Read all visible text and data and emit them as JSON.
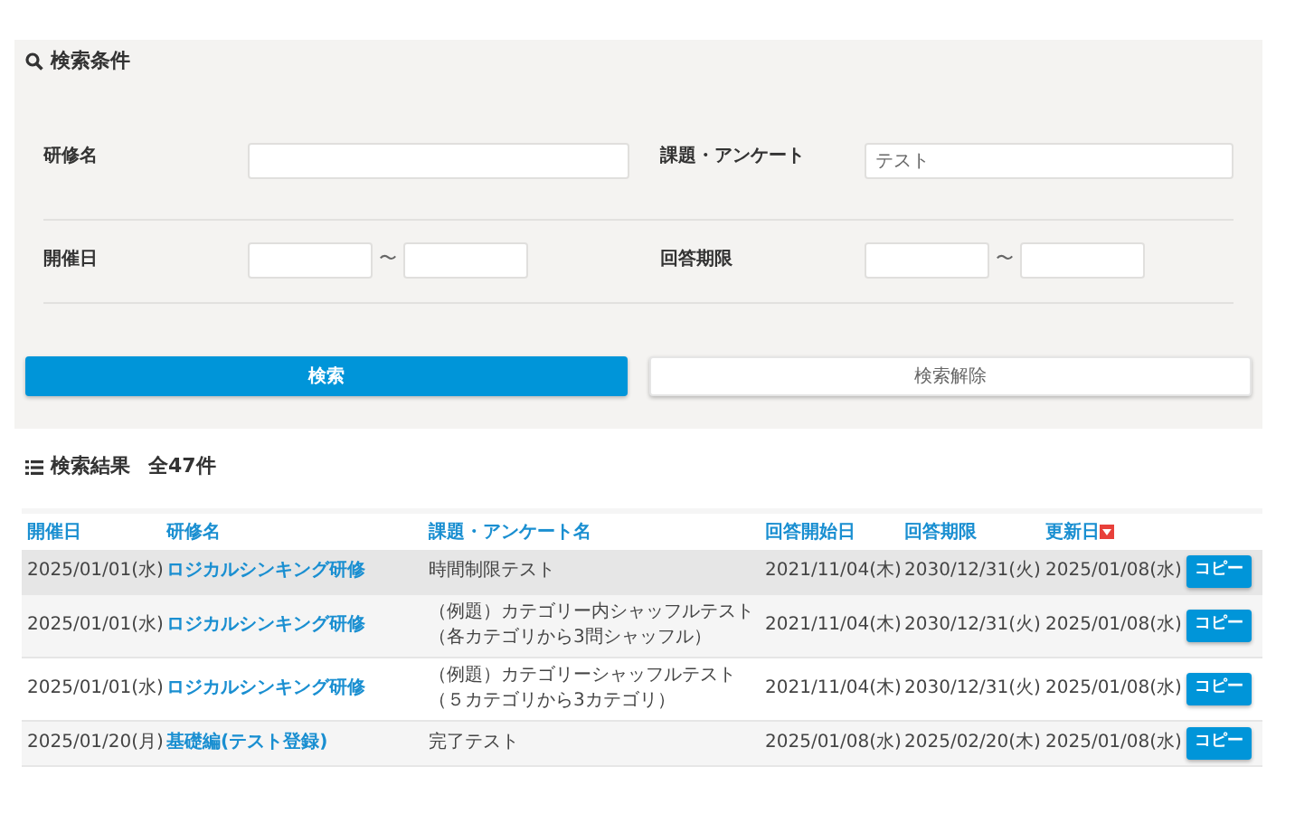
{
  "search": {
    "title": "検索条件",
    "fields": [
      {
        "label": "研修名",
        "kind": "text"
      },
      {
        "label": "課題・アンケート",
        "kind": "text",
        "value": "テスト"
      },
      {
        "label": "開催日",
        "kind": "range",
        "separator": "〜"
      },
      {
        "label": "回答期限",
        "kind": "range",
        "separator": "〜"
      }
    ],
    "buttons": [
      {
        "label": "検索",
        "kind": "primary"
      },
      {
        "label": "検索解除",
        "kind": "secondary"
      }
    ]
  },
  "results": {
    "title": "検索結果",
    "count": "全47件",
    "columns": [
      {
        "label": "開催日",
        "sorted": false
      },
      {
        "label": "研修名",
        "sorted": false
      },
      {
        "label": "課題・アンケート名",
        "sorted": false
      },
      {
        "label": "回答開始日",
        "sorted": false
      },
      {
        "label": "回答期限",
        "sorted": false
      },
      {
        "label": "更新日",
        "sorted": true
      }
    ],
    "rows": [
      {
        "selected": true,
        "cells": [
          "2025/01/01(水)",
          "ロジカルシンキング研修",
          "時間制限テスト",
          "2021/11/04(木)",
          "2030/12/31(火)",
          "2025/01/08(水)"
        ],
        "button": "コピー"
      },
      {
        "selected": false,
        "cells": [
          "2025/01/01(水)",
          "ロジカルシンキング研修",
          "（例題）カテゴリー内シャッフルテスト（各カテゴリから3問シャッフル）",
          "2021/11/04(木)",
          "2030/12/31(火)",
          "2025/01/08(水)"
        ],
        "button": "コピー"
      },
      {
        "selected": false,
        "cells": [
          "2025/01/01(水)",
          "ロジカルシンキング研修",
          "（例題）カテゴリーシャッフルテスト（５カテゴリから3カテゴリ）",
          "2021/11/04(木)",
          "2030/12/31(火)",
          "2025/01/08(水)"
        ],
        "button": "コピー"
      },
      {
        "selected": false,
        "cells": [
          "2025/01/20(月)",
          "基礎編(テスト登録)",
          "完了テスト",
          "2025/01/08(水)",
          "2025/02/20(木)",
          "2025/01/08(水)"
        ],
        "button": "コピー"
      }
    ]
  }
}
